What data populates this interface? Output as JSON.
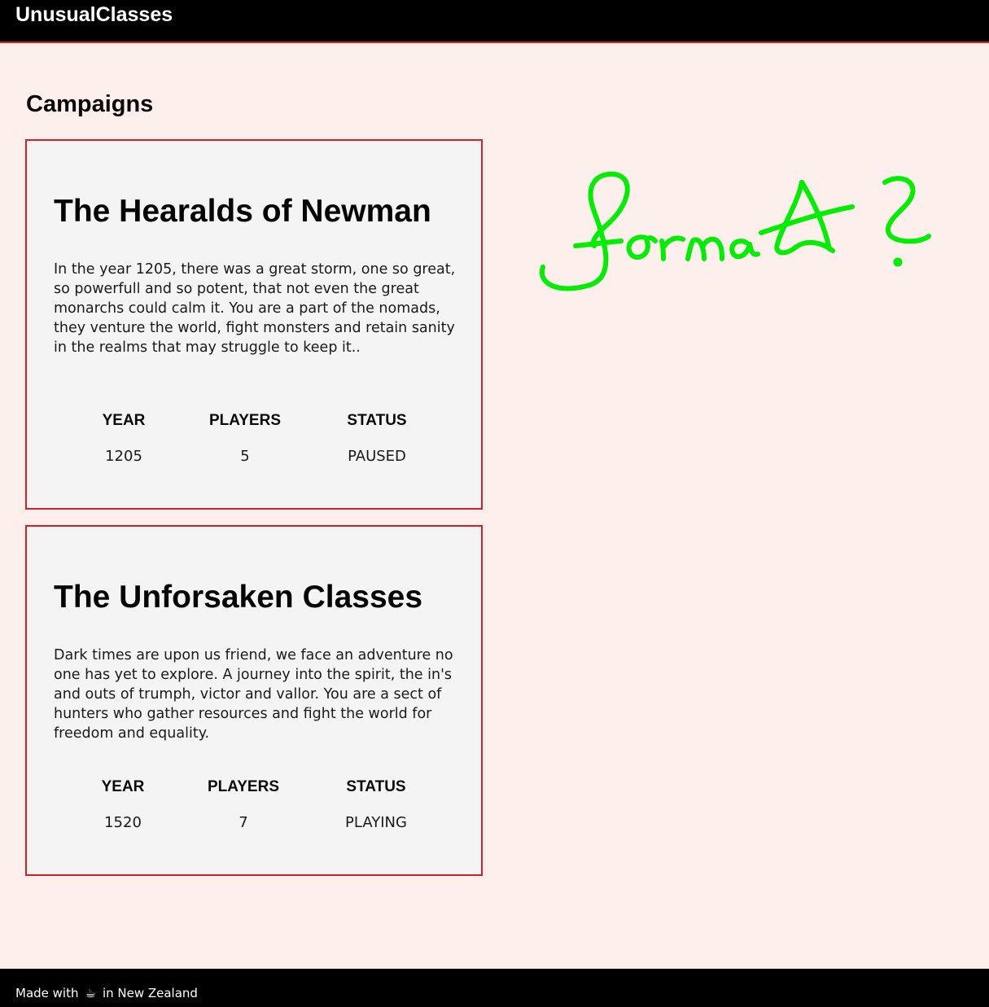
{
  "header": {
    "brand": "UnusualClasses"
  },
  "main": {
    "title": "Campaigns",
    "campaigns": [
      {
        "title": "The Hearalds of Newman",
        "description": "In the year 1205, there was a great storm, one so great, so powerfull and so potent, that not even the great monarchs could calm it. You are a part of the nomads, they venture the world, fight monsters and retain sanity in the realms that may struggle to keep it..",
        "stats": [
          {
            "label": "YEAR",
            "value": "1205"
          },
          {
            "label": "PLAYERS",
            "value": "5"
          },
          {
            "label": "STATUS",
            "value": "PAUSED"
          }
        ]
      },
      {
        "title": "The Unforsaken Classes",
        "description": "Dark times are upon us friend, we face an adventure no one has yet to explore. A journey into the spirit, the in's and outs of trumph, victor and vallor. You are a sect of hunters who gather resources and fight the world for freedom and equality.",
        "stats": [
          {
            "label": "YEAR",
            "value": "1520"
          },
          {
            "label": "PLAYERS",
            "value": "7"
          },
          {
            "label": "STATUS",
            "value": "PLAYING"
          }
        ]
      }
    ]
  },
  "annotation": {
    "text": "format?",
    "color": "#00ee00"
  },
  "footer": {
    "prefix": "Made with",
    "icon": "coffee-icon",
    "suffix": "in New Zealand"
  },
  "colors": {
    "accent": "#d42020",
    "background": "#fdf0ec",
    "card": "#f4f4f4",
    "bar": "#000000"
  }
}
